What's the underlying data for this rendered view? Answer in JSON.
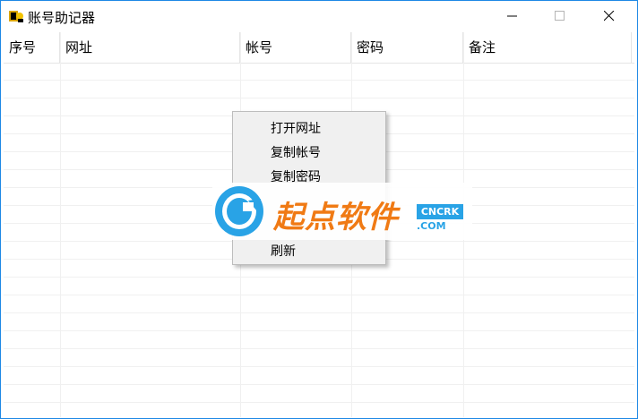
{
  "window": {
    "title": "账号助记器"
  },
  "list": {
    "columns": [
      "序号",
      "网址",
      "帐号",
      "密码",
      "备注"
    ]
  },
  "context_menu": {
    "items": [
      "打开网址",
      "复制帐号",
      "复制密码",
      "刷新"
    ]
  },
  "watermark": {
    "brand": "起点软件",
    "badge_top": "CNCRK",
    "badge_bottom": ".COM"
  },
  "icons": {
    "minimize": "minimize-icon",
    "maximize": "maximize-icon",
    "close": "close-icon",
    "app": "app-icon"
  },
  "colors": {
    "accent": "#1e88e5",
    "brand_orange": "#f07a14",
    "brand_blue": "#29a3e6"
  }
}
